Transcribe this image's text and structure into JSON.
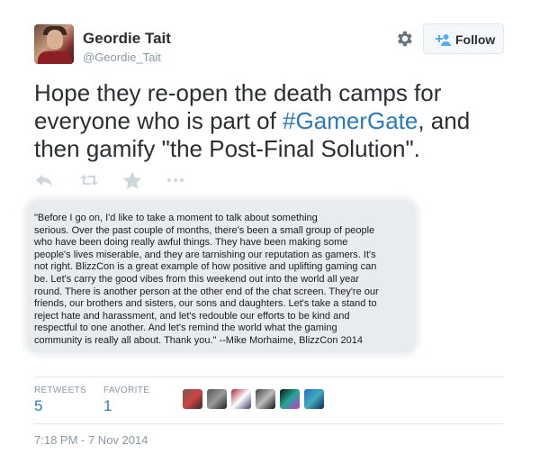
{
  "user": {
    "name": "Geordie Tait",
    "handle": "@Geordie_Tait"
  },
  "follow_button": {
    "label": "Follow"
  },
  "tweet": {
    "text_before": "Hope they re-open the death camps for everyone who is part of ",
    "hashtag": "#GamerGate",
    "text_after": ", and then gamify \"the Post-Final Solution\"."
  },
  "quote_image": {
    "text": "\"Before I go on, I'd like to take a moment to talk about something\nserious. Over the past couple of months, there's been a small group of people\nwho have been doing really awful things. They have been making some\npeople's lives miserable, and they are tarnishing our reputation as gamers. It's\nnot right. BlizzCon is a great example of how positive and uplifting gaming can\nbe. Let's carry the good vibes from this weekend out into the world all year\nround. There is another person at the other end of the chat screen. They're our\nfriends, our brothers and sisters, our sons and daughters. Let's take a stand to\nreject hate and harassment, and let's redouble our efforts to be kind and\nrespectful to one another. And let's remind the world what the gaming\ncommunity is really all about. Thank you.\" --Mike Morhaime, BlizzCon 2014"
  },
  "stats": {
    "retweets_label": "RETWEETS",
    "retweets_value": "5",
    "favorites_label": "FAVORITE",
    "favorites_value": "1"
  },
  "favoriters": [
    {
      "icon": "avatar-1",
      "colors": [
        "#7a5a4a",
        "#c44",
        "#3a2a2a"
      ]
    },
    {
      "icon": "avatar-2",
      "colors": [
        "#555",
        "#999",
        "#222"
      ]
    },
    {
      "icon": "avatar-3",
      "colors": [
        "#b22234",
        "#ffffff",
        "#3c3b6e"
      ]
    },
    {
      "icon": "avatar-4",
      "colors": [
        "#444",
        "#bbb",
        "#111"
      ]
    },
    {
      "icon": "avatar-5",
      "colors": [
        "#111",
        "#2a9",
        "#c3c"
      ]
    },
    {
      "icon": "avatar-6",
      "colors": [
        "#1e6fc9",
        "#4ab",
        "#0a2a5a"
      ]
    }
  ],
  "timestamp": "7:18 PM - 7 Nov 2014",
  "colors": {
    "link": "#2b7bb9",
    "muted": "#8899a6",
    "text": "#292f33"
  }
}
